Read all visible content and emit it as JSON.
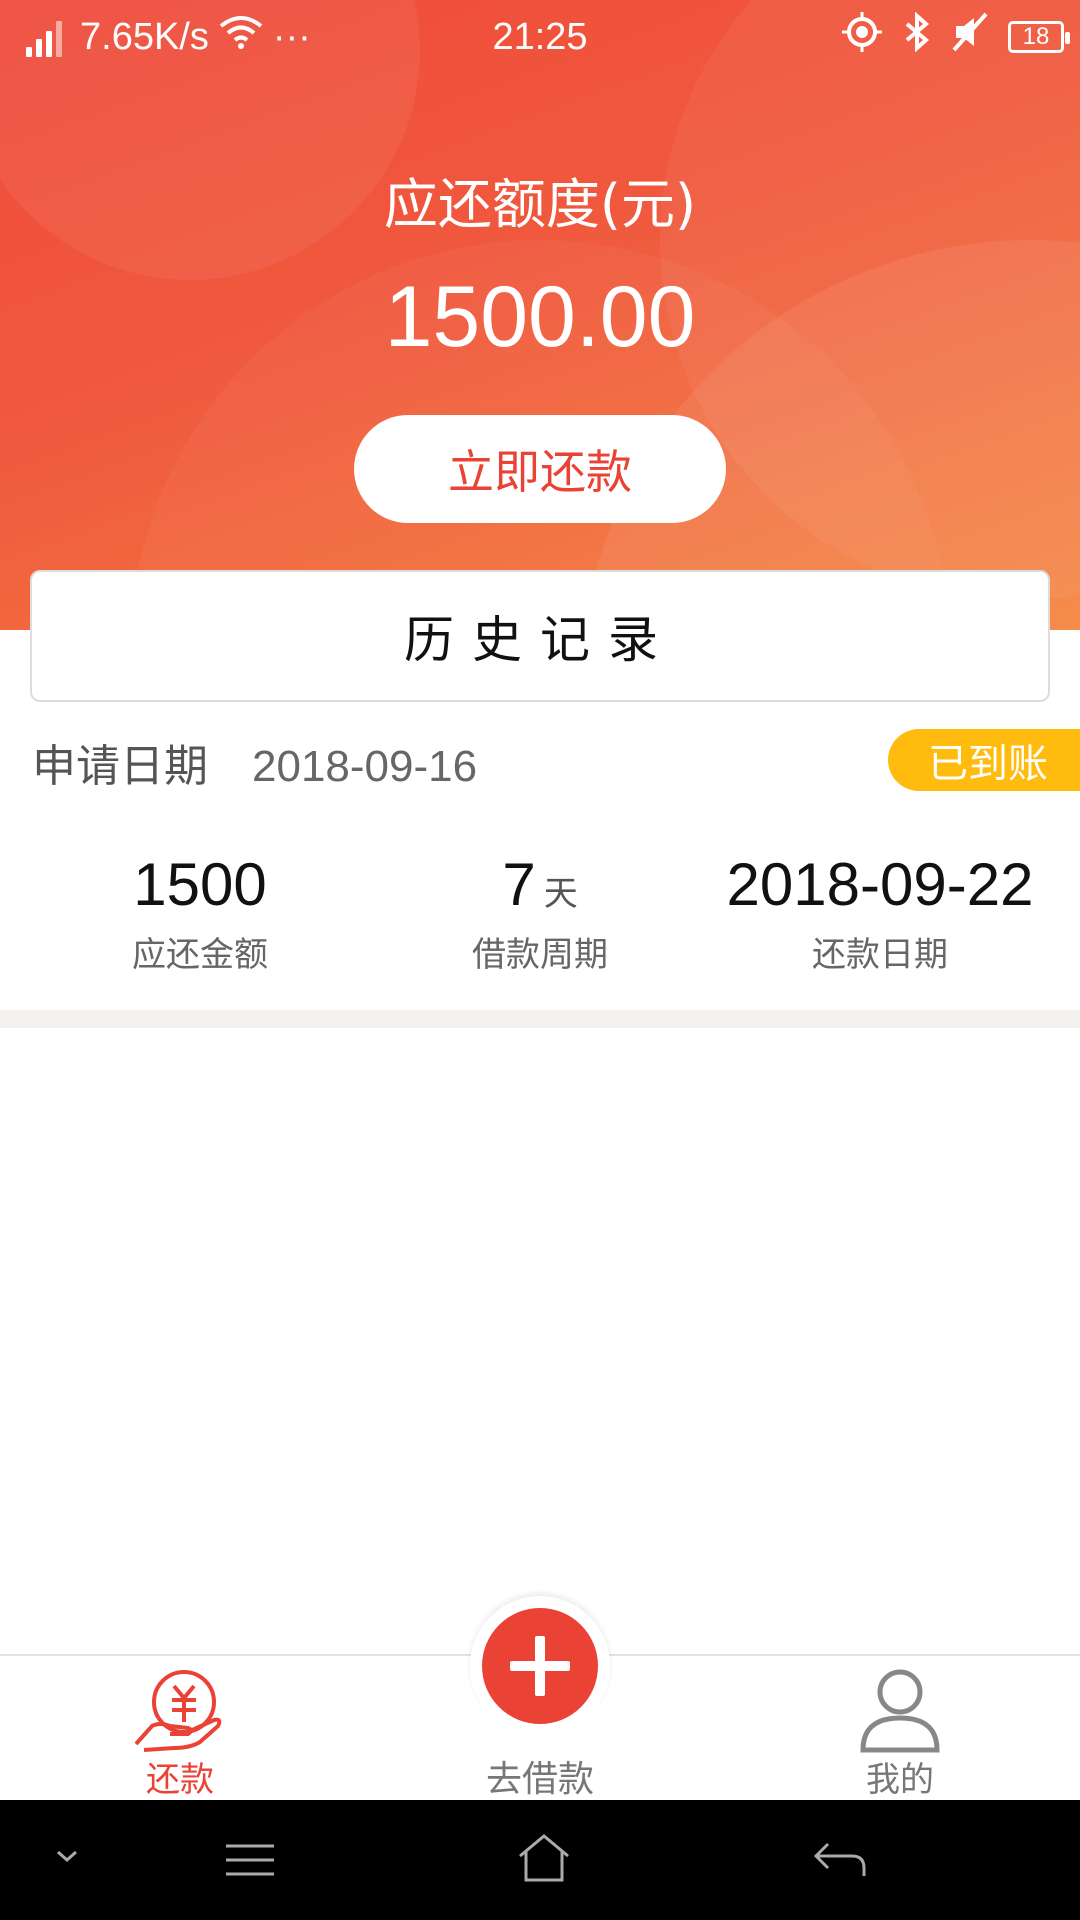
{
  "status_bar": {
    "speed": "7.65K/s",
    "more": "···",
    "time": "21:25",
    "battery": "18"
  },
  "hero": {
    "label": "应还额度(元)",
    "amount": "1500.00",
    "repay_button": "立即还款"
  },
  "history_button": "历史记录",
  "record": {
    "apply_label": "申请日期",
    "apply_date": "2018-09-16",
    "status_badge": "已到账",
    "stats": [
      {
        "value": "1500",
        "unit": "",
        "label": "应还金额"
      },
      {
        "value": "7",
        "unit": "天",
        "label": "借款周期"
      },
      {
        "value": "2018-09-22",
        "unit": "",
        "label": "还款日期"
      }
    ]
  },
  "tabbar": {
    "repay": "还款",
    "borrow": "去借款",
    "mine": "我的"
  },
  "colors": {
    "accent": "#ea4235",
    "gradient_start": "#ef4a3a",
    "gradient_end": "#f5843d",
    "badge": "#ffbb0e"
  },
  "icons": [
    "signal-icon",
    "wifi-icon",
    "location-icon",
    "bluetooth-icon",
    "mute-icon",
    "battery-icon",
    "repay-hand-yen-icon",
    "plus-icon",
    "user-icon",
    "chevron-down-icon",
    "menu-icon",
    "home-icon",
    "back-icon"
  ]
}
